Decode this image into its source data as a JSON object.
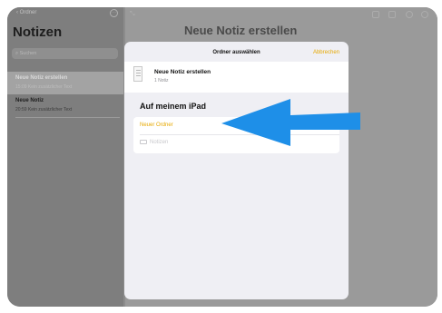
{
  "sidebar": {
    "back_label": "Ordner",
    "title": "Notizen",
    "search_placeholder": "Suchen",
    "notes": [
      {
        "title": "Neue Notiz erstellen",
        "subtitle": "15:09 Kein zusätzlicher Text"
      },
      {
        "title": "Neue Notiz",
        "subtitle": "20:59 Kein zusätzlicher Text"
      }
    ]
  },
  "content": {
    "title": "Neue Notiz erstellen"
  },
  "modal": {
    "title": "Ordner auswählen",
    "cancel_label": "Abbrechen",
    "note": {
      "name": "Neue Notiz erstellen",
      "count": "1 Notiz"
    },
    "section_title": "Auf meinem iPad",
    "new_folder_label": "Neuer Ordner",
    "folders": [
      {
        "name": "Notizen"
      }
    ]
  },
  "colors": {
    "accent": "#e6a800",
    "arrow": "#1e8fe8",
    "dim_overlay": "#8c8c8c"
  },
  "icons": [
    "back-chevron-icon",
    "search-icon",
    "more-icon",
    "document-icon",
    "folder-icon",
    "blue-arrow-annotation"
  ]
}
